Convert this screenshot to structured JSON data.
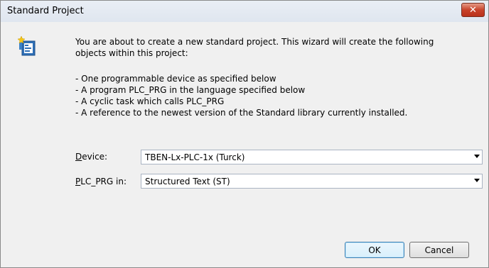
{
  "window": {
    "title": "Standard Project",
    "close_glyph": "✕"
  },
  "icon": {
    "name": "wizard-project-icon"
  },
  "intro": {
    "line1": "You are about to create a new standard project. This wizard will create the following",
    "line2": "objects within this project:"
  },
  "bullets": [
    "- One programmable device as specified below",
    "- A program PLC_PRG in the language specified below",
    "- A cyclic task which calls PLC_PRG",
    "- A reference to the newest version of the Standard library currently installed."
  ],
  "device": {
    "label_underlined": "D",
    "label_rest": "evice:",
    "value": "TBEN-Lx-PLC-1x (Turck)"
  },
  "plc_prg": {
    "label_underlined": "P",
    "label_rest": "LC_PRG in:",
    "value": "Structured Text (ST)"
  },
  "buttons": {
    "ok": "OK",
    "cancel": "Cancel"
  }
}
